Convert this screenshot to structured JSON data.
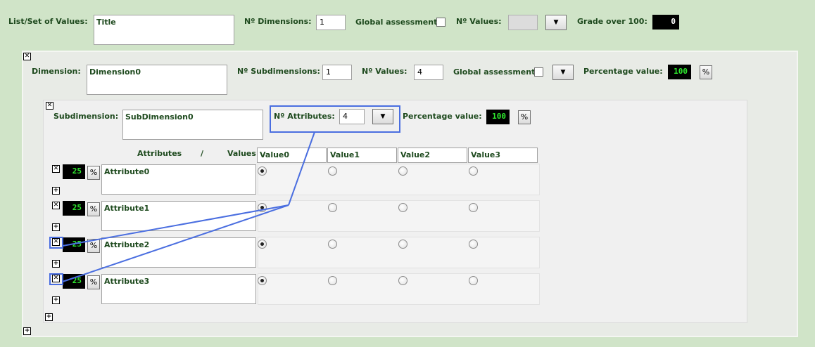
{
  "top": {
    "list_label": "List/Set of Values:",
    "list_value": "Title",
    "n_dimensions_label": "Nº Dimensions:",
    "n_dimensions_value": "1",
    "global_assessment_label": "Global assessment",
    "n_values_label": "Nº Values:",
    "grade_label": "Grade over 100:",
    "grade_value": "0"
  },
  "dimension": {
    "label": "Dimension:",
    "name": "Dimension0",
    "n_subdimensions_label": "Nº Subdimensions:",
    "n_subdimensions_value": "1",
    "n_values_label": "Nº Values:",
    "n_values_value": "4",
    "global_assessment_label": "Global assessment",
    "percentage_label": "Percentage value:",
    "percentage_value": "100"
  },
  "subdimension": {
    "label": "Subdimension:",
    "name": "SubDimension0",
    "n_attributes_label": "Nº Attributes:",
    "n_attributes_value": "4",
    "percentage_label": "Percentage value:",
    "percentage_value": "100"
  },
  "matrix": {
    "attributes_header": "Attributes",
    "slash": "/",
    "values_header": "Values",
    "columns": [
      "Value0",
      "Value1",
      "Value2",
      "Value3"
    ],
    "rows": [
      {
        "weight": "25",
        "name": "Attribute0",
        "selected": 0
      },
      {
        "weight": "25",
        "name": "Attribute1",
        "selected": 0
      },
      {
        "weight": "25",
        "name": "Attribute2",
        "selected": 0
      },
      {
        "weight": "25",
        "name": "Attribute3",
        "selected": 0
      }
    ]
  },
  "icons": {
    "dropdown": "▼",
    "percent": "%",
    "close": "✕",
    "add": "+"
  },
  "colors": {
    "background": "#d0e4c8",
    "label_text": "#1e4a1e",
    "highlight": "#4a6ee0",
    "value_green": "#2ee82e"
  }
}
